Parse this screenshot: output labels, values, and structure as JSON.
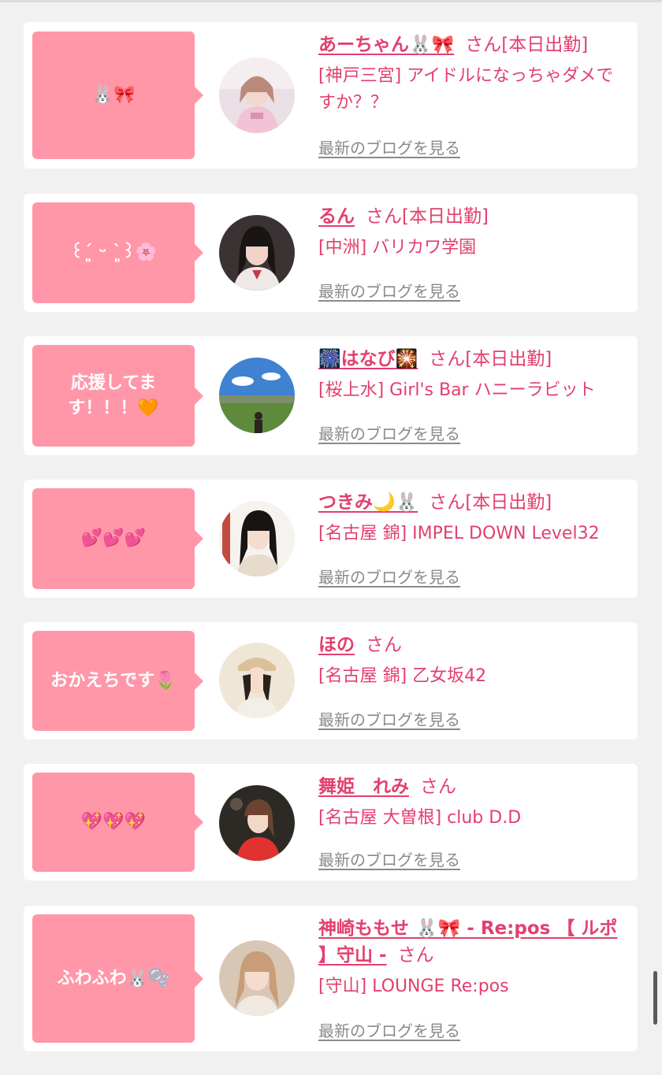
{
  "entries": [
    {
      "message": "🐰🎀",
      "name": "あーちゃん🐰🎀",
      "san": "さん[本日出勤]",
      "place": "[神戸三宮] アイドルになっちゃダメですか？？",
      "blog": "最新のブログを見る"
    },
    {
      "message": "꒰ˊ͈ ᵕ ˋ͈꒱🌸",
      "name": "るん",
      "san": "さん[本日出勤]",
      "place": "[中洲] バリカワ学園",
      "blog": "最新のブログを見る"
    },
    {
      "message": "応援してます！！！🧡",
      "name": "🎆はなび🎇",
      "san": "さん[本日出勤]",
      "place": "[桜上水] Girl's Bar ハニーラビット",
      "blog": "最新のブログを見る"
    },
    {
      "message": "💕💕💕",
      "name": "つきみ🌙🐰",
      "san": "さん[本日出勤]",
      "place": "[名古屋 錦] IMPEL DOWN Level32",
      "blog": "最新のブログを見る"
    },
    {
      "message": "おかえちです🌷",
      "name": "ほの",
      "san": "さん",
      "place": "[名古屋 錦] 乙女坂42",
      "blog": "最新のブログを見る"
    },
    {
      "message": "💖💖💖",
      "name": "舞姫　れみ",
      "san": "さん",
      "place": "[名古屋 大曽根] club D.D",
      "blog": "最新のブログを見る"
    },
    {
      "message": "ふわふわ🐰🫧",
      "name": "神崎ももせ 🐰🎀 - Re:pos 【 ルポ 】守山 -",
      "san": "さん",
      "place": "[守山] LOUNGE Re:pos",
      "blog": "最新のブログを見る"
    }
  ],
  "colors": {
    "accent": "#e33f6e",
    "bubble": "#ff97a8",
    "background": "#f1f1f1",
    "link_gray": "#8a8a8a"
  },
  "icons": [
    "avatar-photo",
    "scroll-indicator"
  ]
}
